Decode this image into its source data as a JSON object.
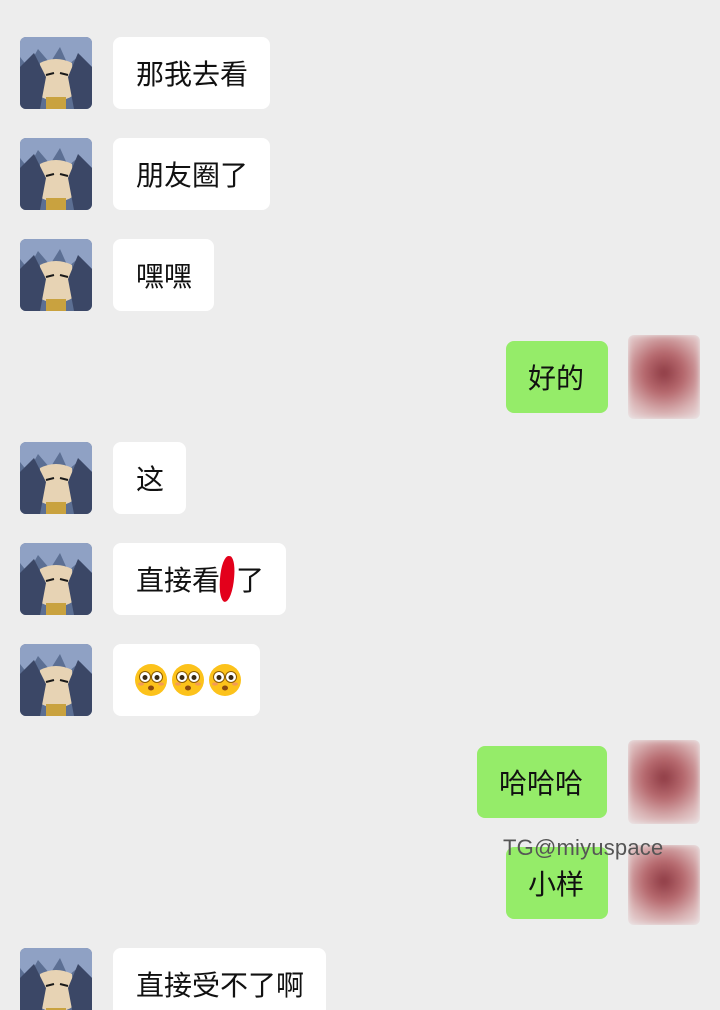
{
  "messages": [
    {
      "side": "left",
      "text": "那我去看"
    },
    {
      "side": "left",
      "text": "朋友圈了"
    },
    {
      "side": "left",
      "text": "嘿嘿"
    },
    {
      "side": "right",
      "text": "好的"
    },
    {
      "side": "left",
      "text": "这"
    },
    {
      "side": "left",
      "text_before": "直接看",
      "text_after": "了"
    },
    {
      "side": "left",
      "emoji": [
        "flushed-face",
        "flushed-face",
        "flushed-face"
      ]
    },
    {
      "side": "right",
      "text": "哈哈哈"
    },
    {
      "side": "right",
      "text": "小样"
    },
    {
      "side": "left",
      "text": "直接受不了啊"
    }
  ],
  "watermark": "TG@miyuspace",
  "colors": {
    "background": "#ededed",
    "received_bubble": "#ffffff",
    "sent_bubble": "#95ec69",
    "redaction": "#e3001b"
  },
  "icons": {
    "contact_avatar": "anime-character-avatar-icon",
    "self_avatar": "blurred-avatar-icon",
    "emoji": "flushed-face-emoji-icon"
  }
}
